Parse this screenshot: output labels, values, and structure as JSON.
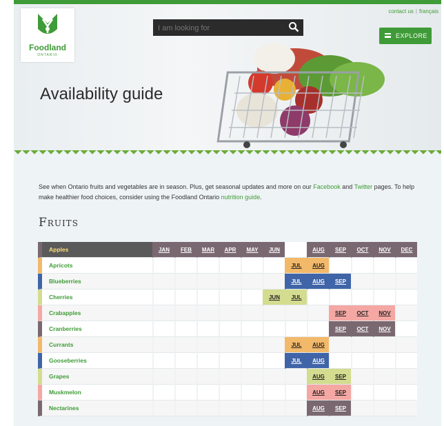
{
  "header": {
    "logo_text": "Foodland",
    "logo_sub": "ONTARIO",
    "links": [
      "contact us",
      "français"
    ],
    "search_placeholder": "I am looking for",
    "explore_label": "EXPLORE",
    "hero_title": "Availability guide"
  },
  "intro": {
    "part1": "See when Ontario fruits and vegetables are in season. Plus, get seasonal updates and more on our ",
    "link_facebook": "Facebook",
    "part2": " and ",
    "link_twitter": "Twitter",
    "part3": " pages. To help make healthier food choices, consider using the Foodland Ontario ",
    "link_nutrition": "nutrition guide",
    "part4": "."
  },
  "section_heading": "Fruits",
  "months": [
    "JAN",
    "FEB",
    "MAR",
    "APR",
    "MAY",
    "JUN",
    "JUL",
    "AUG",
    "SEP",
    "OCT",
    "NOV",
    "DEC"
  ],
  "colors": {
    "orange": "#f3b96a",
    "blue": "#3f64a8",
    "yellowgreen": "#d3dc8f",
    "pink": "#f4a7a3",
    "mauve": "#7a6870",
    "green_text": "#3f9b37"
  },
  "fruits": [
    {
      "name": "Apples",
      "color": "#7a6870",
      "months": [
        "JAN",
        "FEB",
        "MAR",
        "APR",
        "MAY",
        "JUN",
        "AUG",
        "SEP",
        "OCT",
        "NOV",
        "DEC"
      ],
      "header": true
    },
    {
      "name": "Apricots",
      "color": "#f3b96a",
      "months": [
        "JUL",
        "AUG"
      ]
    },
    {
      "name": "Blueberries",
      "color": "#3f64a8",
      "months": [
        "JUL",
        "AUG",
        "SEP"
      ]
    },
    {
      "name": "Cherries",
      "color": "#d3dc8f",
      "months": [
        "JUN",
        "JUL"
      ]
    },
    {
      "name": "Crabapples",
      "color": "#f4a7a3",
      "months": [
        "SEP",
        "OCT",
        "NOV"
      ]
    },
    {
      "name": "Cranberries",
      "color": "#7a6870",
      "months": [
        "SEP",
        "OCT",
        "NOV"
      ]
    },
    {
      "name": "Currants",
      "color": "#f3b96a",
      "months": [
        "JUL",
        "AUG"
      ]
    },
    {
      "name": "Gooseberries",
      "color": "#3f64a8",
      "months": [
        "JUL",
        "AUG"
      ]
    },
    {
      "name": "Grapes",
      "color": "#d3dc8f",
      "months": [
        "AUG",
        "SEP"
      ]
    },
    {
      "name": "Muskmelon",
      "color": "#f4a7a3",
      "months": [
        "AUG",
        "SEP"
      ]
    },
    {
      "name": "Nectarines",
      "color": "#7a6870",
      "months": [
        "AUG",
        "SEP"
      ]
    }
  ]
}
